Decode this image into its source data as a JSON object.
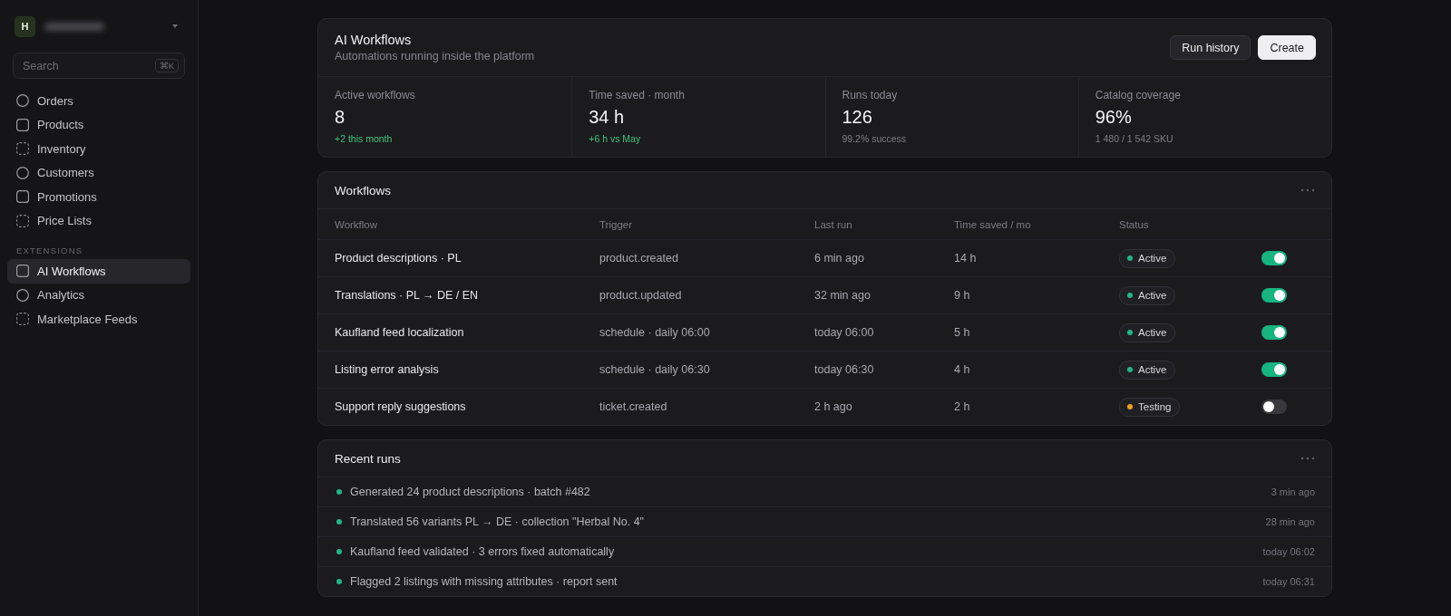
{
  "sidebar": {
    "workspace": {
      "initial": "H"
    },
    "search": {
      "placeholder": "Search",
      "shortcut": "⌘K"
    },
    "nav": [
      {
        "label": "Orders",
        "kind": "circle",
        "selected": false
      },
      {
        "label": "Products",
        "kind": "square",
        "selected": false
      },
      {
        "label": "Inventory",
        "kind": "dashed",
        "selected": false
      },
      {
        "label": "Customers",
        "kind": "circle",
        "selected": false
      },
      {
        "label": "Promotions",
        "kind": "square",
        "selected": false
      },
      {
        "label": "Price Lists",
        "kind": "dashed",
        "selected": false
      }
    ],
    "section_label": "EXTENSIONS",
    "extensions": [
      {
        "label": "AI Workflows",
        "kind": "square",
        "selected": true
      },
      {
        "label": "Analytics",
        "kind": "circle",
        "selected": false
      },
      {
        "label": "Marketplace Feeds",
        "kind": "dashed",
        "selected": false
      }
    ]
  },
  "header": {
    "title": "AI Workflows",
    "subtitle": "Automations running inside the platform",
    "buttons": [
      {
        "label": "Run history",
        "kind": "secondary"
      },
      {
        "label": "Create",
        "kind": "primary"
      }
    ]
  },
  "stats": [
    {
      "label": "Active workflows",
      "value": "8",
      "note": "+2 this month",
      "positive": true
    },
    {
      "label": "Time saved · month",
      "value": "34 h",
      "note": "+6 h vs May",
      "positive": true
    },
    {
      "label": "Runs today",
      "value": "126",
      "note": "99.2% success",
      "positive": false
    },
    {
      "label": "Catalog coverage",
      "value": "96%",
      "note": "1 480 / 1 542 SKU",
      "positive": false
    }
  ],
  "workflows": {
    "title": "Workflows",
    "columns": [
      "Workflow",
      "Trigger",
      "Last run",
      "Time saved / mo",
      "Status"
    ],
    "rows": [
      {
        "name": "Product descriptions · PL",
        "trigger": "product.created",
        "last_run": "6 min ago",
        "time_saved": "14 h",
        "status": "Active",
        "color": "#22b585",
        "on": true
      },
      {
        "name": "Translations · PL → DE / EN",
        "trigger": "product.updated",
        "last_run": "32 min ago",
        "time_saved": "9 h",
        "status": "Active",
        "color": "#22b585",
        "on": true
      },
      {
        "name": "Kaufland feed localization",
        "trigger": "schedule · daily 06:00",
        "last_run": "today 06:00",
        "time_saved": "5 h",
        "status": "Active",
        "color": "#22b585",
        "on": true
      },
      {
        "name": "Listing error analysis",
        "trigger": "schedule · daily 06:30",
        "last_run": "today 06:30",
        "time_saved": "4 h",
        "status": "Active",
        "color": "#22b585",
        "on": true
      },
      {
        "name": "Support reply suggestions",
        "trigger": "ticket.created",
        "last_run": "2 h ago",
        "time_saved": "2 h",
        "status": "Testing",
        "color": "#f0a020",
        "on": false
      }
    ]
  },
  "recent_runs": {
    "title": "Recent runs",
    "items": [
      {
        "text": "Generated 24 product descriptions · batch #482",
        "time": "3 min ago",
        "color": "#22b585"
      },
      {
        "text": "Translated 56 variants PL → DE · collection \"Herbal No. 4\"",
        "time": "28 min ago",
        "color": "#22b585"
      },
      {
        "text": "Kaufland feed validated · 3 errors fixed automatically",
        "time": "today 06:02",
        "color": "#22b585"
      },
      {
        "text": "Flagged 2 listings with missing attributes · report sent",
        "time": "today 06:31",
        "color": "#22b585"
      }
    ]
  }
}
